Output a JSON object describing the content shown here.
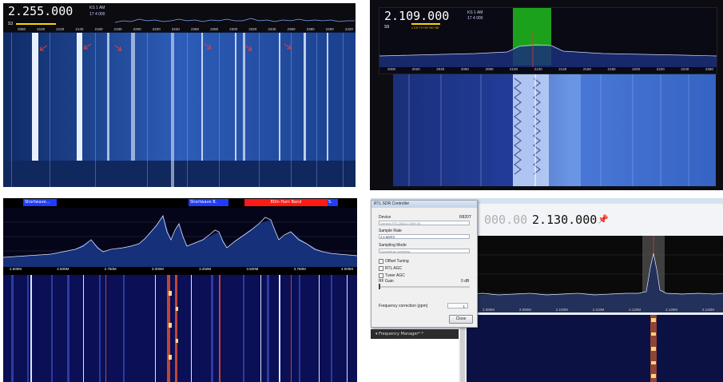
{
  "panel1": {
    "frequency": "2.255.000",
    "mode_line1": "KS 1  AM",
    "mode_line2": "17  4 000",
    "signal": "S3",
    "ticks": [
      "2080",
      "2100",
      "2120",
      "2140",
      "2160",
      "2180",
      "2200",
      "2220",
      "2240",
      "2260",
      "2280",
      "2300",
      "2320",
      "2340",
      "2360",
      "2380",
      "2400",
      "2420"
    ]
  },
  "panel2": {
    "frequency": "2.109.000",
    "mode_line1": "KS 1  AM",
    "mode_line2": "17  4 000",
    "signal": "S9",
    "scale": "1  3  5  7  9  +20  +40  +60",
    "ticks": [
      "2000",
      "2020",
      "2040",
      "2060",
      "2080",
      "2100",
      "2120",
      "2140",
      "2160",
      "2180",
      "2200",
      "2220",
      "2240",
      "2260"
    ]
  },
  "panel3": {
    "bands": [
      {
        "label": "Shortwave...",
        "color": "#1e3cff"
      },
      {
        "label": "Shortwave B.",
        "color": "#1e3cff"
      },
      {
        "label": "80m Ham Band",
        "color": "#ff1a1a"
      },
      {
        "label": "S.",
        "color": "#1e3cff"
      }
    ],
    "ticks": [
      "2.500M",
      "2.600M",
      "2.750M",
      "3.000M",
      "3.250M",
      "3.500M",
      "3.750M",
      "4.000M"
    ]
  },
  "panel4": {
    "frequency_dim": "000.00",
    "frequency": "2.130.000",
    "ticks": [
      "2.080M",
      "2.090M",
      "2.100M",
      "2.110M",
      "2.120M",
      "2.130M",
      "2.140M"
    ]
  },
  "dialog": {
    "title": "RTL SDR Controller",
    "device_label": "Device",
    "device_value": "Generic RTL2832U OEM (0)",
    "tuner": "R820T",
    "sample_rate_label": "Sample Rate",
    "sample_rate_value": "2.4 MSPS",
    "sampling_mode_label": "Sampling Mode",
    "sampling_mode_value": "Quadrature sampling",
    "offset_tuning": "Offset Tuning",
    "rtl_agc": "RTL AGC",
    "tuner_agc": "Tuner AGC",
    "rf_gain_label": "RF Gain",
    "rf_gain_value": "0 dB",
    "freq_correction_label": "Frequency correction (ppm)",
    "freq_correction_value": "1",
    "close_label": "Close"
  },
  "freq_manager": "Frequency Manager*  *"
}
